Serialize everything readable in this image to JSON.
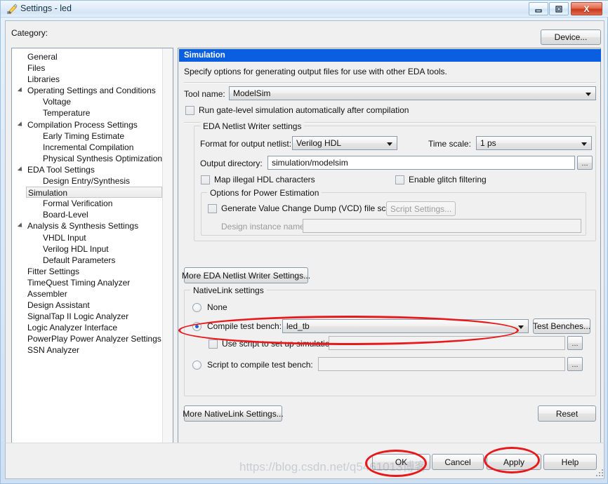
{
  "window": {
    "title": "Settings - led",
    "icon": "pencil-icon",
    "controls": {
      "minimize": "–",
      "restore": "□",
      "close": "X"
    }
  },
  "category": {
    "label": "Category:",
    "device_button": "Device...",
    "items": [
      {
        "label": "General",
        "level": 0,
        "expandable": false,
        "selected": false
      },
      {
        "label": "Files",
        "level": 0,
        "expandable": false,
        "selected": false
      },
      {
        "label": "Libraries",
        "level": 0,
        "expandable": false,
        "selected": false
      },
      {
        "label": "Operating Settings and Conditions",
        "level": 0,
        "expandable": true,
        "selected": false
      },
      {
        "label": "Voltage",
        "level": 1,
        "expandable": false,
        "selected": false
      },
      {
        "label": "Temperature",
        "level": 1,
        "expandable": false,
        "selected": false
      },
      {
        "label": "Compilation Process Settings",
        "level": 0,
        "expandable": true,
        "selected": false
      },
      {
        "label": "Early Timing Estimate",
        "level": 1,
        "expandable": false,
        "selected": false
      },
      {
        "label": "Incremental Compilation",
        "level": 1,
        "expandable": false,
        "selected": false
      },
      {
        "label": "Physical Synthesis Optimizations",
        "level": 1,
        "expandable": false,
        "selected": false
      },
      {
        "label": "EDA Tool Settings",
        "level": 0,
        "expandable": true,
        "selected": false
      },
      {
        "label": "Design Entry/Synthesis",
        "level": 1,
        "expandable": false,
        "selected": false
      },
      {
        "label": "Simulation",
        "level": 1,
        "expandable": false,
        "selected": true
      },
      {
        "label": "Formal Verification",
        "level": 1,
        "expandable": false,
        "selected": false
      },
      {
        "label": "Board-Level",
        "level": 1,
        "expandable": false,
        "selected": false
      },
      {
        "label": "Analysis & Synthesis Settings",
        "level": 0,
        "expandable": true,
        "selected": false
      },
      {
        "label": "VHDL Input",
        "level": 1,
        "expandable": false,
        "selected": false
      },
      {
        "label": "Verilog HDL Input",
        "level": 1,
        "expandable": false,
        "selected": false
      },
      {
        "label": "Default Parameters",
        "level": 1,
        "expandable": false,
        "selected": false
      },
      {
        "label": "Fitter Settings",
        "level": 0,
        "expandable": false,
        "selected": false
      },
      {
        "label": "TimeQuest Timing Analyzer",
        "level": 0,
        "expandable": false,
        "selected": false
      },
      {
        "label": "Assembler",
        "level": 0,
        "expandable": false,
        "selected": false
      },
      {
        "label": "Design Assistant",
        "level": 0,
        "expandable": false,
        "selected": false
      },
      {
        "label": "SignalTap II Logic Analyzer",
        "level": 0,
        "expandable": false,
        "selected": false
      },
      {
        "label": "Logic Analyzer Interface",
        "level": 0,
        "expandable": false,
        "selected": false
      },
      {
        "label": "PowerPlay Power Analyzer Settings",
        "level": 0,
        "expandable": false,
        "selected": false
      },
      {
        "label": "SSN Analyzer",
        "level": 0,
        "expandable": false,
        "selected": false
      }
    ]
  },
  "panel": {
    "header": "Simulation",
    "header_color": "#0a5fe0",
    "description": "Specify options for generating output files for use with other EDA tools.",
    "tool_name_label": "Tool name:",
    "tool_name_value": "ModelSim",
    "run_gatelevel_label": "Run gate-level simulation automatically after compilation",
    "run_gatelevel_checked": false
  },
  "netlist_writer": {
    "group_title": "EDA Netlist Writer settings",
    "format_label": "Format for output netlist:",
    "format_value": "Verilog HDL",
    "timescale_label": "Time scale:",
    "timescale_value": "1 ps",
    "output_dir_label": "Output directory:",
    "output_dir_value": "simulation/modelsim",
    "browse_label": "...",
    "map_illegal_label": "Map illegal HDL characters",
    "map_illegal_checked": false,
    "glitch_filter_label": "Enable glitch filtering",
    "glitch_filter_checked": false,
    "power": {
      "group_title": "Options for Power Estimation",
      "vcd_label": "Generate Value Change Dump (VCD) file script",
      "vcd_checked": false,
      "script_settings_button": "Script Settings...",
      "script_settings_enabled": false,
      "design_instance_label": "Design instance name:",
      "design_instance_value": "",
      "design_instance_enabled": false
    },
    "more_settings_button": "More EDA Netlist Writer Settings..."
  },
  "nativelink": {
    "group_title": "NativeLink settings",
    "option_none": "None",
    "option_compile_testbench": "Compile test bench:",
    "option_script_compile": "Script to compile test bench:",
    "selected_option": "compile_testbench",
    "testbench_value": "led_tb",
    "test_benches_button": "Test Benches...",
    "use_script_label": "Use script to set up simulation:",
    "use_script_checked": false,
    "use_script_value": "",
    "script_compile_value": "",
    "browse_label": "...",
    "more_settings_button": "More NativeLink Settings...",
    "reset_button": "Reset"
  },
  "footer": {
    "ok": "OK",
    "cancel": "Cancel",
    "apply": "Apply",
    "help": "Help"
  },
  "annotations": {
    "color": "#e8191b",
    "circled": [
      "compile-test-bench-row",
      "ok-button",
      "apply-button"
    ]
  },
  "watermark": {
    "text": "https://blog.csdn.net/q5461013博客"
  }
}
